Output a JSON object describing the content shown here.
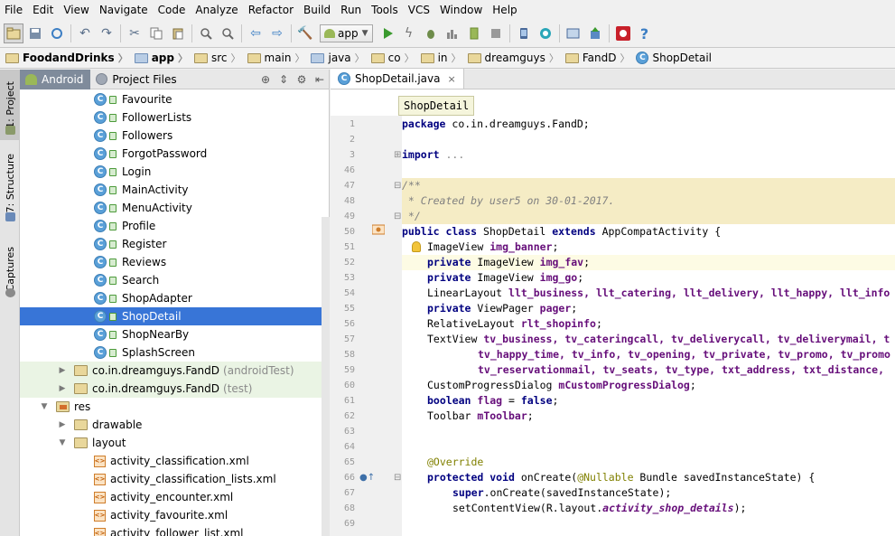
{
  "menu": [
    "File",
    "Edit",
    "View",
    "Navigate",
    "Code",
    "Analyze",
    "Refactor",
    "Build",
    "Run",
    "Tools",
    "VCS",
    "Window",
    "Help"
  ],
  "toolbar": {
    "run_config": "app",
    "icons": [
      "open-folder-icon",
      "save-icon",
      "sync-icon",
      "undo-icon",
      "redo-icon",
      "cut-icon",
      "copy-icon",
      "paste-icon",
      "find-icon",
      "replace-icon",
      "back-icon",
      "forward-icon",
      "build-icon",
      "run-icon",
      "apply-changes-icon",
      "debug-icon",
      "profile-icon",
      "attach-icon",
      "stop-icon",
      "avd-manager-icon",
      "sdk-manager-icon",
      "gradle-sync-icon",
      "project-structure-icon",
      "device-monitor-icon",
      "android-device-icon",
      "help-icon"
    ]
  },
  "breadcrumbs": [
    "FoodandDrinks",
    "app",
    "src",
    "main",
    "java",
    "co",
    "in",
    "dreamguys",
    "FandD",
    "ShopDetail"
  ],
  "left_strip": {
    "tabs": [
      "1: Project",
      "7: Structure",
      "Captures"
    ]
  },
  "project": {
    "tabs": [
      "Android",
      "Project Files"
    ],
    "tree": [
      {
        "label": "Favourite",
        "type": "class"
      },
      {
        "label": "FollowerLists",
        "type": "class"
      },
      {
        "label": "Followers",
        "type": "class"
      },
      {
        "label": "ForgotPassword",
        "type": "class"
      },
      {
        "label": "Login",
        "type": "class"
      },
      {
        "label": "MainActivity",
        "type": "class"
      },
      {
        "label": "MenuActivity",
        "type": "class"
      },
      {
        "label": "Profile",
        "type": "class"
      },
      {
        "label": "Register",
        "type": "class"
      },
      {
        "label": "Reviews",
        "type": "class"
      },
      {
        "label": "Search",
        "type": "class"
      },
      {
        "label": "ShopAdapter",
        "type": "class"
      },
      {
        "label": "ShopDetail",
        "type": "class"
      },
      {
        "label": "ShopNearBy",
        "type": "class"
      },
      {
        "label": "SplashScreen",
        "type": "class"
      },
      {
        "label": "co.in.dreamguys.FandD",
        "suffix": "(androidTest)",
        "type": "package"
      },
      {
        "label": "co.in.dreamguys.FandD",
        "suffix": "(test)",
        "type": "package"
      },
      {
        "label": "res",
        "type": "res"
      },
      {
        "label": "drawable",
        "type": "folder"
      },
      {
        "label": "layout",
        "type": "folder"
      },
      {
        "label": "activity_classification.xml",
        "type": "xml"
      },
      {
        "label": "activity_classification_lists.xml",
        "type": "xml"
      },
      {
        "label": "activity_encounter.xml",
        "type": "xml"
      },
      {
        "label": "activity_favourite.xml",
        "type": "xml"
      },
      {
        "label": "activity_follower_list.xml",
        "type": "xml"
      }
    ]
  },
  "editor": {
    "tab_label": "ShopDetail.java",
    "hint": "ShopDetail",
    "line_numbers": [
      "1",
      "2",
      "3",
      "46",
      "47",
      "48",
      "49",
      "50",
      "51",
      "52",
      "53",
      "54",
      "55",
      "56",
      "57",
      "58",
      "59",
      "60",
      "61",
      "62",
      "63",
      "64",
      "65",
      "66",
      "67",
      "68",
      "69"
    ],
    "lines": {
      "package": {
        "kw": "package",
        "rest": " co.in.dreamguys.FandD;"
      },
      "import": {
        "kw": "import",
        "rest": " ..."
      },
      "doc_open": "/**",
      "doc_body": " * Created by user5 on 30-01-2017.",
      "doc_close": " */",
      "class_decl": {
        "kw1": "public class",
        "name": " ShopDetail ",
        "kw2": "extends",
        "rest": " AppCompatActivity {"
      },
      "l51": {
        "type": "ImageView ",
        "field": "img_banner",
        "end": ";"
      },
      "l52": {
        "kw": "private",
        "type": " ImageView ",
        "field": "img_fav",
        "end": ";"
      },
      "l53": {
        "kw": "private",
        "type": " ImageView ",
        "field": "img_go",
        "end": ";"
      },
      "l54": {
        "type": "LinearLayout ",
        "fields": "llt_business, llt_catering, llt_delivery, llt_happy, llt_info"
      },
      "l55": {
        "kw": "private",
        "type": " ViewPager ",
        "field": "pager",
        "end": ";"
      },
      "l56": {
        "type": "RelativeLayout ",
        "field": "rlt_shopinfo",
        "end": ";"
      },
      "l57": {
        "type": "TextView ",
        "fields": "tv_business, tv_cateringcall, tv_deliverycall, tv_deliverymail, t"
      },
      "l58": {
        "fields": "tv_happy_time, tv_info, tv_opening, tv_private, tv_promo, tv_promo"
      },
      "l59": {
        "fields": "tv_reservationmail, tv_seats, tv_type, txt_address, txt_distance,"
      },
      "l60": {
        "type": "CustomProgressDialog ",
        "field": "mCustomProgressDialog",
        "end": ";"
      },
      "l61": {
        "kw": "boolean",
        "field": " flag",
        "mid": " = ",
        "kw2": "false",
        "end": ";"
      },
      "l62": {
        "type": "Toolbar ",
        "field": "mToolbar",
        "end": ";"
      },
      "l65": {
        "ann": "@Override"
      },
      "l66": {
        "kw": "protected void",
        "name": " onCreate(",
        "ann": "@Nullable",
        "rest": " Bundle savedInstanceState) {"
      },
      "l67": {
        "kw": "super",
        "rest": ".onCreate(savedInstanceState);"
      },
      "l68": {
        "pre": "setContentView(R.layout.",
        "field": "activity_shop_details",
        "end": ");"
      }
    }
  }
}
